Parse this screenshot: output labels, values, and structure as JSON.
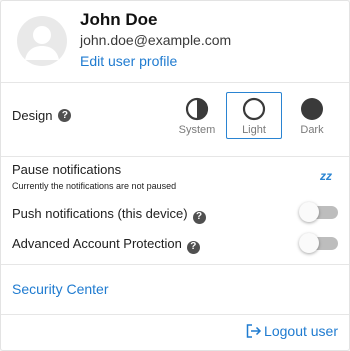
{
  "profile": {
    "name": "John Doe",
    "email": "john.doe@example.com",
    "edit_label": "Edit user profile"
  },
  "design": {
    "label": "Design",
    "help_glyph": "?",
    "options": [
      {
        "label": "System",
        "icon": "half-circle-icon"
      },
      {
        "label": "Light",
        "icon": "empty-circle-icon"
      },
      {
        "label": "Dark",
        "icon": "filled-circle-icon"
      }
    ],
    "selected": "Light"
  },
  "notifications": {
    "pause_label": "Pause notifications",
    "pause_status": "Currently the notifications are not paused",
    "pause_icon": "zz",
    "push_label": "Push notifications (this device)",
    "push_enabled": false,
    "aap_label": "Advanced Account Protection",
    "aap_enabled": false
  },
  "links": {
    "security_center": "Security Center",
    "logout": "Logout user"
  },
  "colors": {
    "accent": "#1f7bd0",
    "selected_border": "#2a84d2",
    "toggle_off": "#bdbdbd"
  }
}
